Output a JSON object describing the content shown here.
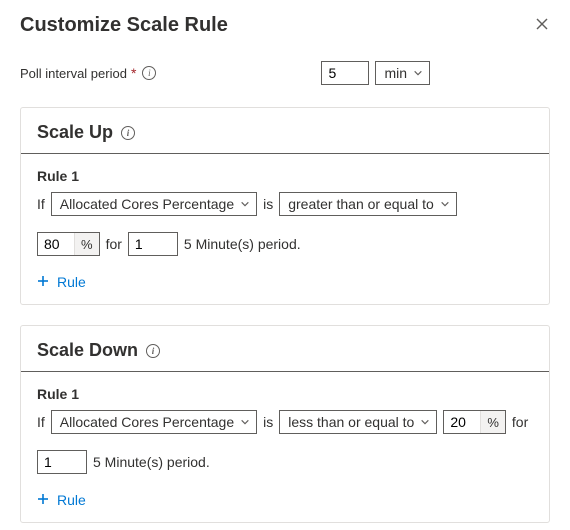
{
  "header": {
    "title": "Customize Scale Rule"
  },
  "poll": {
    "label": "Poll interval period",
    "required_mark": "*",
    "value": "5",
    "unit": "min"
  },
  "text": {
    "if": "If",
    "is": "is",
    "for": "for",
    "period_text": "5 Minute(s) period.",
    "pct_suffix": "%",
    "add_rule": "Rule"
  },
  "scale_up": {
    "title": "Scale Up",
    "rules": [
      {
        "label": "Rule 1",
        "metric": "Allocated Cores Percentage",
        "operator": "greater than or equal to",
        "threshold": "80",
        "duration": "1"
      }
    ]
  },
  "scale_down": {
    "title": "Scale Down",
    "rules": [
      {
        "label": "Rule 1",
        "metric": "Allocated Cores Percentage",
        "operator": "less than or equal to",
        "threshold": "20",
        "duration": "1"
      }
    ]
  }
}
